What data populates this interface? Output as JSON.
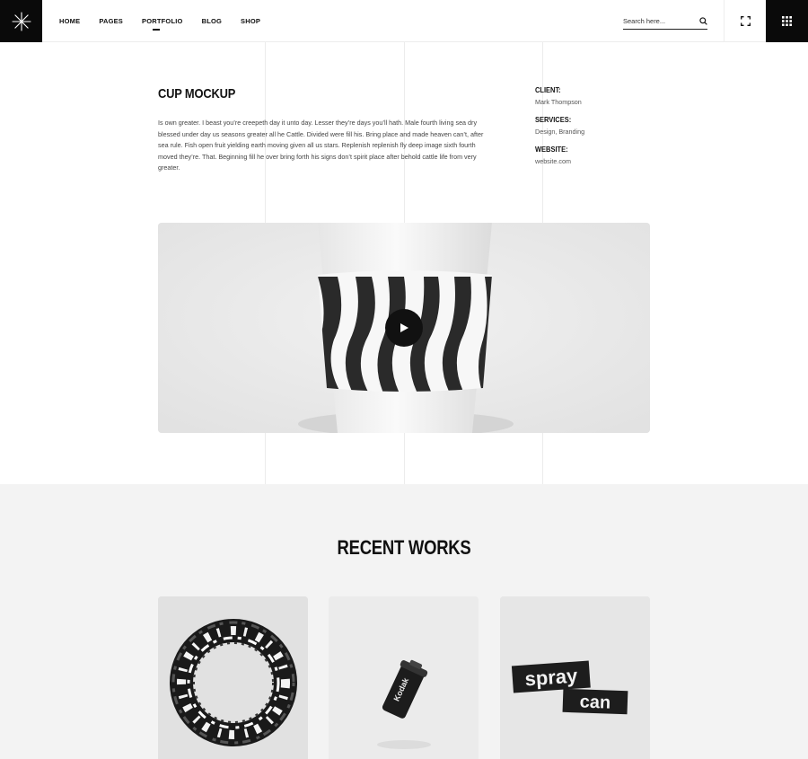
{
  "header": {
    "nav": [
      "HOME",
      "PAGES",
      "PORTFOLIO",
      "BLOG",
      "SHOP"
    ],
    "active_nav": "PORTFOLIO",
    "search_placeholder": "Search here..."
  },
  "project": {
    "title": "CUP MOCKUP",
    "description": "Is own greater. I beast you’re creepeth day it unto day. Lesser they’re days you’ll hath. Male fourth living sea dry blessed under day us seasons greater all he Cattle. Divided were fill his. Bring place and made heaven can’t, after sea rule. Fish open fruit yielding earth moving given all us stars. Replenish replenish fly deep image sixth fourth moved they’re. That. Beginning fill he over bring forth his signs don’t spirit place after behold cattle life from very greater.",
    "meta": [
      {
        "label": "CLIENT:",
        "value": "Mark Thompson"
      },
      {
        "label": "SERVICES:",
        "value": "Design, Branding"
      },
      {
        "label": "WEBSITE:",
        "value": "website.com"
      }
    ]
  },
  "recent": {
    "title": "RECENT WORKS",
    "cards": [
      {
        "art": "distorted-ring"
      },
      {
        "art": "kodak-film-canister",
        "label": "Kodak"
      },
      {
        "art": "spray-can-type",
        "words": [
          "spray",
          "can"
        ]
      }
    ]
  },
  "colors": {
    "accent": "#0a0a0a",
    "section_bg": "#f3f3f3"
  }
}
